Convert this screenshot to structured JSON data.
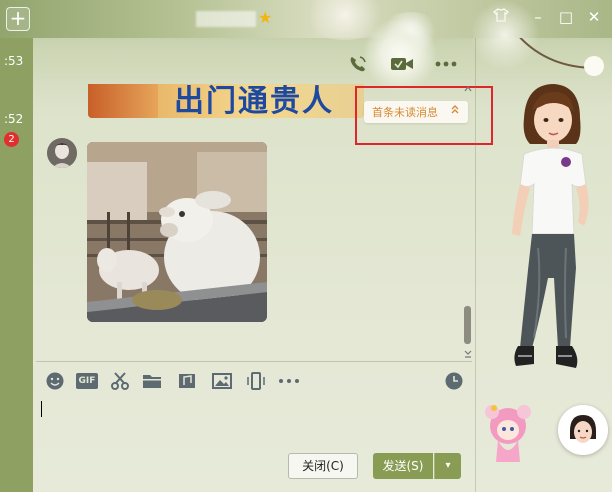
{
  "window": {
    "add_symbol": "+",
    "controls": {
      "skin": "👕",
      "minimize": "–",
      "maximize": "□",
      "close": "✕"
    }
  },
  "sidebar": {
    "times": [
      ":53",
      ":52"
    ],
    "unread_count": "2"
  },
  "chat_header": {
    "icons": [
      "voice-call-icon",
      "video-call-icon",
      "more-icon"
    ]
  },
  "messages": {
    "banner_text": "出门通贵人"
  },
  "unread_notice": {
    "label": "首条未读消息",
    "arrow": "»"
  },
  "scrollbar": {
    "up": "▲",
    "down": "✕"
  },
  "toolbar": {
    "gif_label": "GIF",
    "icons": [
      "emoji-icon",
      "gif-icon",
      "screenshot-icon",
      "folder-icon",
      "music-icon",
      "image-icon",
      "shake-icon",
      "more-icon",
      "history-icon"
    ]
  },
  "footer": {
    "close_label": "关闭(C)",
    "send_label": "发送(S)",
    "send_more": "▾"
  },
  "colors": {
    "accent": "#899c54",
    "unread_text": "#d78a34",
    "highlight": "#e0262a",
    "badge": "#e0302e"
  }
}
